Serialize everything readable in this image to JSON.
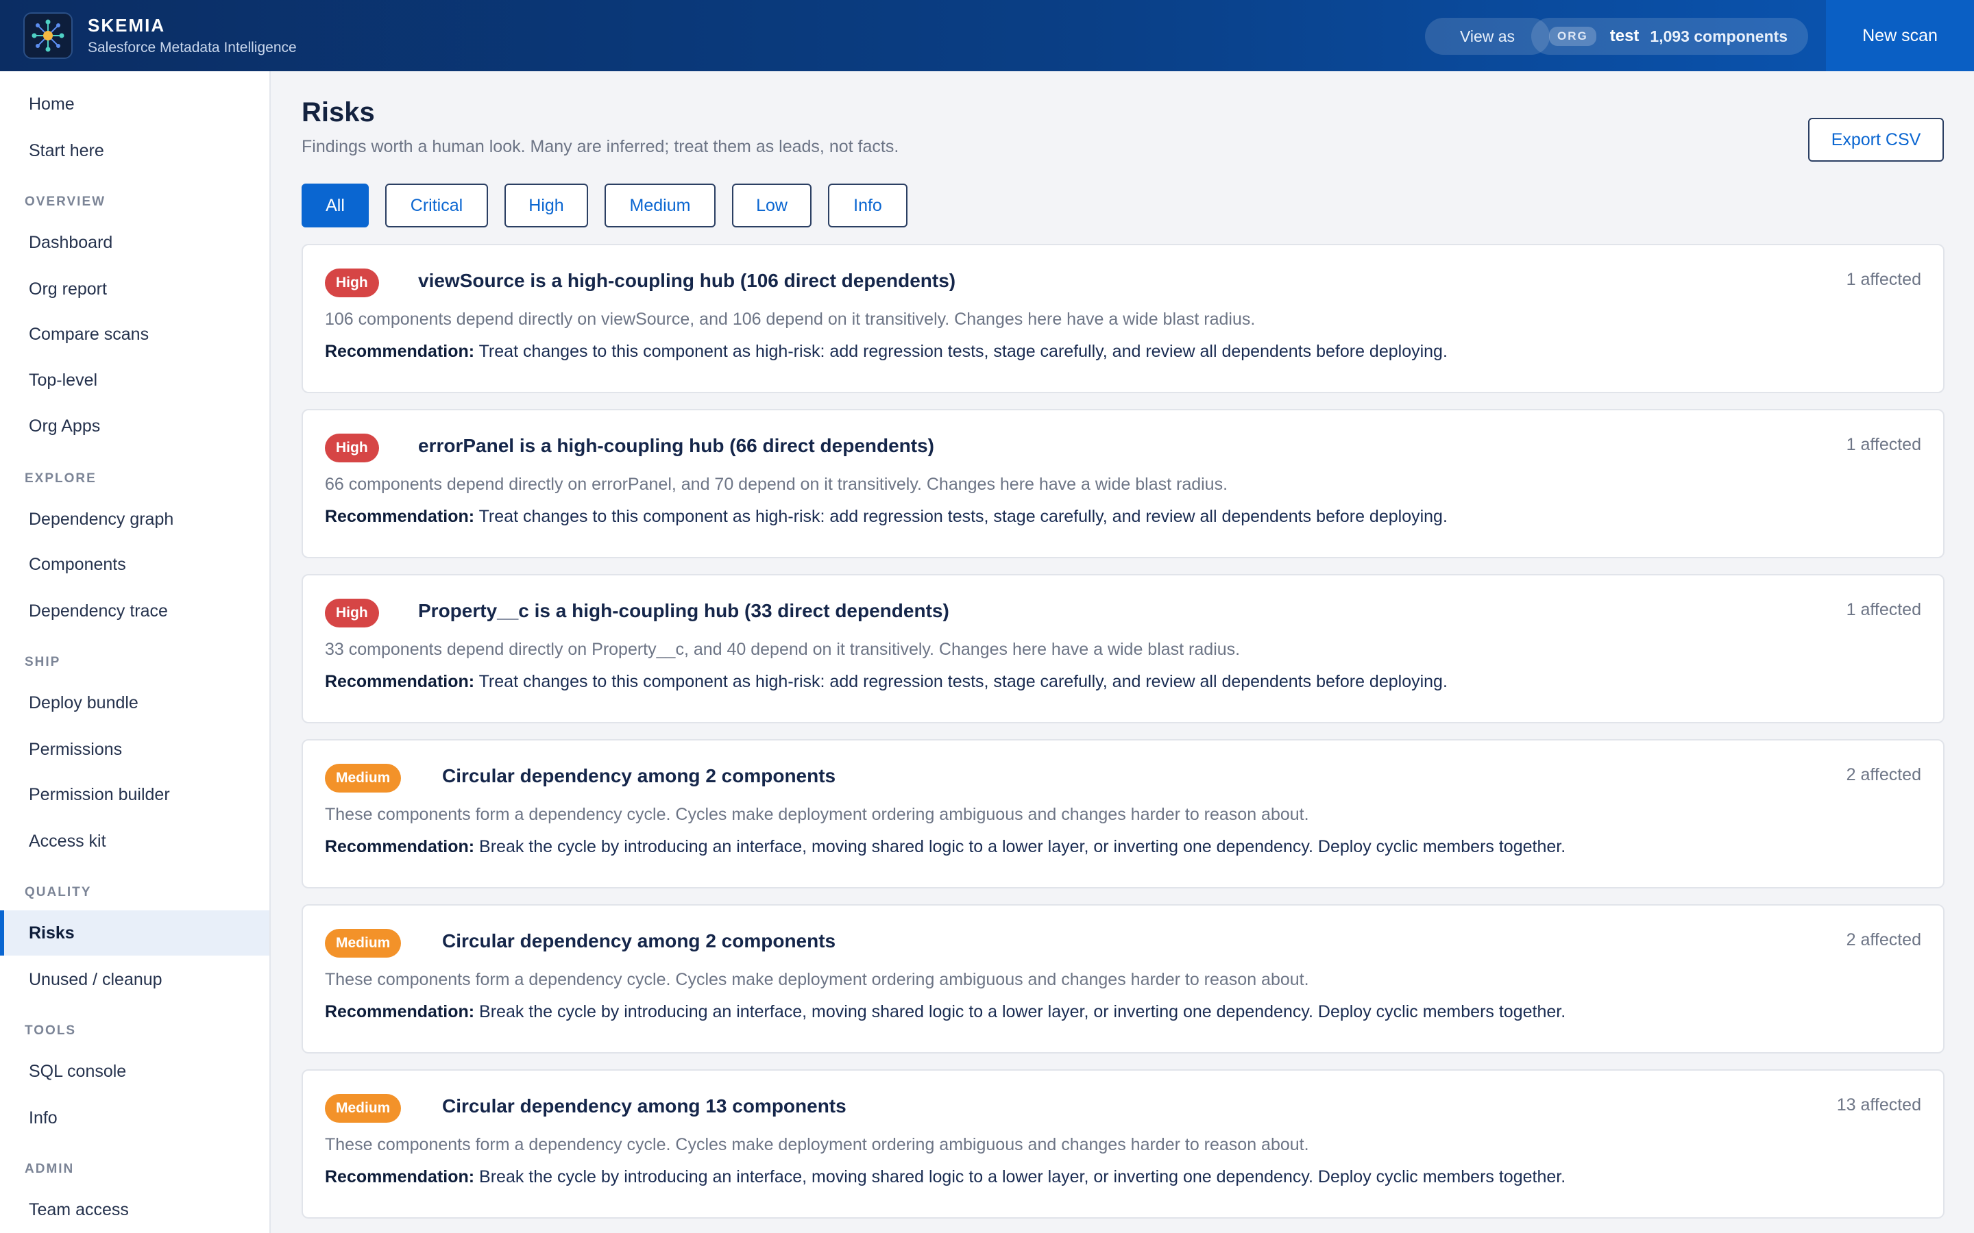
{
  "header": {
    "brand_name": "SKEMIA",
    "brand_sub": "Salesforce Metadata Intelligence",
    "view_as": "View as",
    "org_tag": "ORG",
    "org_name": "test",
    "org_count": "1,093 components",
    "new_scan": "New scan"
  },
  "sidebar": {
    "top": [
      {
        "label": "Home"
      },
      {
        "label": "Start here"
      }
    ],
    "sections": {
      "overview": "OVERVIEW",
      "explore": "EXPLORE",
      "ship": "SHIP",
      "quality": "QUALITY",
      "tools": "TOOLS",
      "admin": "ADMIN"
    },
    "overview": [
      {
        "label": "Dashboard"
      },
      {
        "label": "Org report"
      },
      {
        "label": "Compare scans"
      },
      {
        "label": "Top-level"
      },
      {
        "label": "Org Apps"
      }
    ],
    "explore": [
      {
        "label": "Dependency graph"
      },
      {
        "label": "Components"
      },
      {
        "label": "Dependency trace"
      }
    ],
    "ship": [
      {
        "label": "Deploy bundle"
      },
      {
        "label": "Permissions"
      },
      {
        "label": "Permission builder"
      },
      {
        "label": "Access kit"
      }
    ],
    "quality": [
      {
        "label": "Risks",
        "active": true
      },
      {
        "label": "Unused / cleanup"
      }
    ],
    "tools": [
      {
        "label": "SQL console"
      },
      {
        "label": "Info"
      }
    ],
    "admin": [
      {
        "label": "Team access"
      }
    ]
  },
  "main": {
    "title": "Risks",
    "subtitle": "Findings worth a human look. Many are inferred; treat them as leads, not facts.",
    "export_label": "Export CSV",
    "filters": [
      {
        "label": "All",
        "active": true
      },
      {
        "label": "Critical"
      },
      {
        "label": "High"
      },
      {
        "label": "Medium"
      },
      {
        "label": "Low"
      },
      {
        "label": "Info"
      }
    ],
    "rec_prefix": "Recommendation:",
    "risks": [
      {
        "severity": "High",
        "title": "viewSource is a high-coupling hub (106 direct dependents)",
        "affected": "1 affected",
        "description": "106 components depend directly on viewSource, and 106 depend on it transitively. Changes here have a wide blast radius.",
        "recommendation": "Treat changes to this component as high-risk: add regression tests, stage carefully, and review all dependents before deploying."
      },
      {
        "severity": "High",
        "title": "errorPanel is a high-coupling hub (66 direct dependents)",
        "affected": "1 affected",
        "description": "66 components depend directly on errorPanel, and 70 depend on it transitively. Changes here have a wide blast radius.",
        "recommendation": "Treat changes to this component as high-risk: add regression tests, stage carefully, and review all dependents before deploying."
      },
      {
        "severity": "High",
        "title": "Property__c is a high-coupling hub (33 direct dependents)",
        "affected": "1 affected",
        "description": "33 components depend directly on Property__c, and 40 depend on it transitively. Changes here have a wide blast radius.",
        "recommendation": "Treat changes to this component as high-risk: add regression tests, stage carefully, and review all dependents before deploying."
      },
      {
        "severity": "Medium",
        "title": "Circular dependency among 2 components",
        "affected": "2 affected",
        "description": "These components form a dependency cycle. Cycles make deployment ordering ambiguous and changes harder to reason about.",
        "recommendation": "Break the cycle by introducing an interface, moving shared logic to a lower layer, or inverting one dependency. Deploy cyclic members together."
      },
      {
        "severity": "Medium",
        "title": "Circular dependency among 2 components",
        "affected": "2 affected",
        "description": "These components form a dependency cycle. Cycles make deployment ordering ambiguous and changes harder to reason about.",
        "recommendation": "Break the cycle by introducing an interface, moving shared logic to a lower layer, or inverting one dependency. Deploy cyclic members together."
      },
      {
        "severity": "Medium",
        "title": "Circular dependency among 13 components",
        "affected": "13 affected",
        "description": "These components form a dependency cycle. Cycles make deployment ordering ambiguous and changes harder to reason about.",
        "recommendation": "Break the cycle by introducing an interface, moving shared logic to a lower layer, or inverting one dependency. Deploy cyclic members together."
      }
    ]
  },
  "colors": {
    "accent": "#0a66d1",
    "high": "#d64545",
    "medium": "#f39229",
    "header_start": "#0b2d63",
    "header_end": "#0a56b4"
  }
}
